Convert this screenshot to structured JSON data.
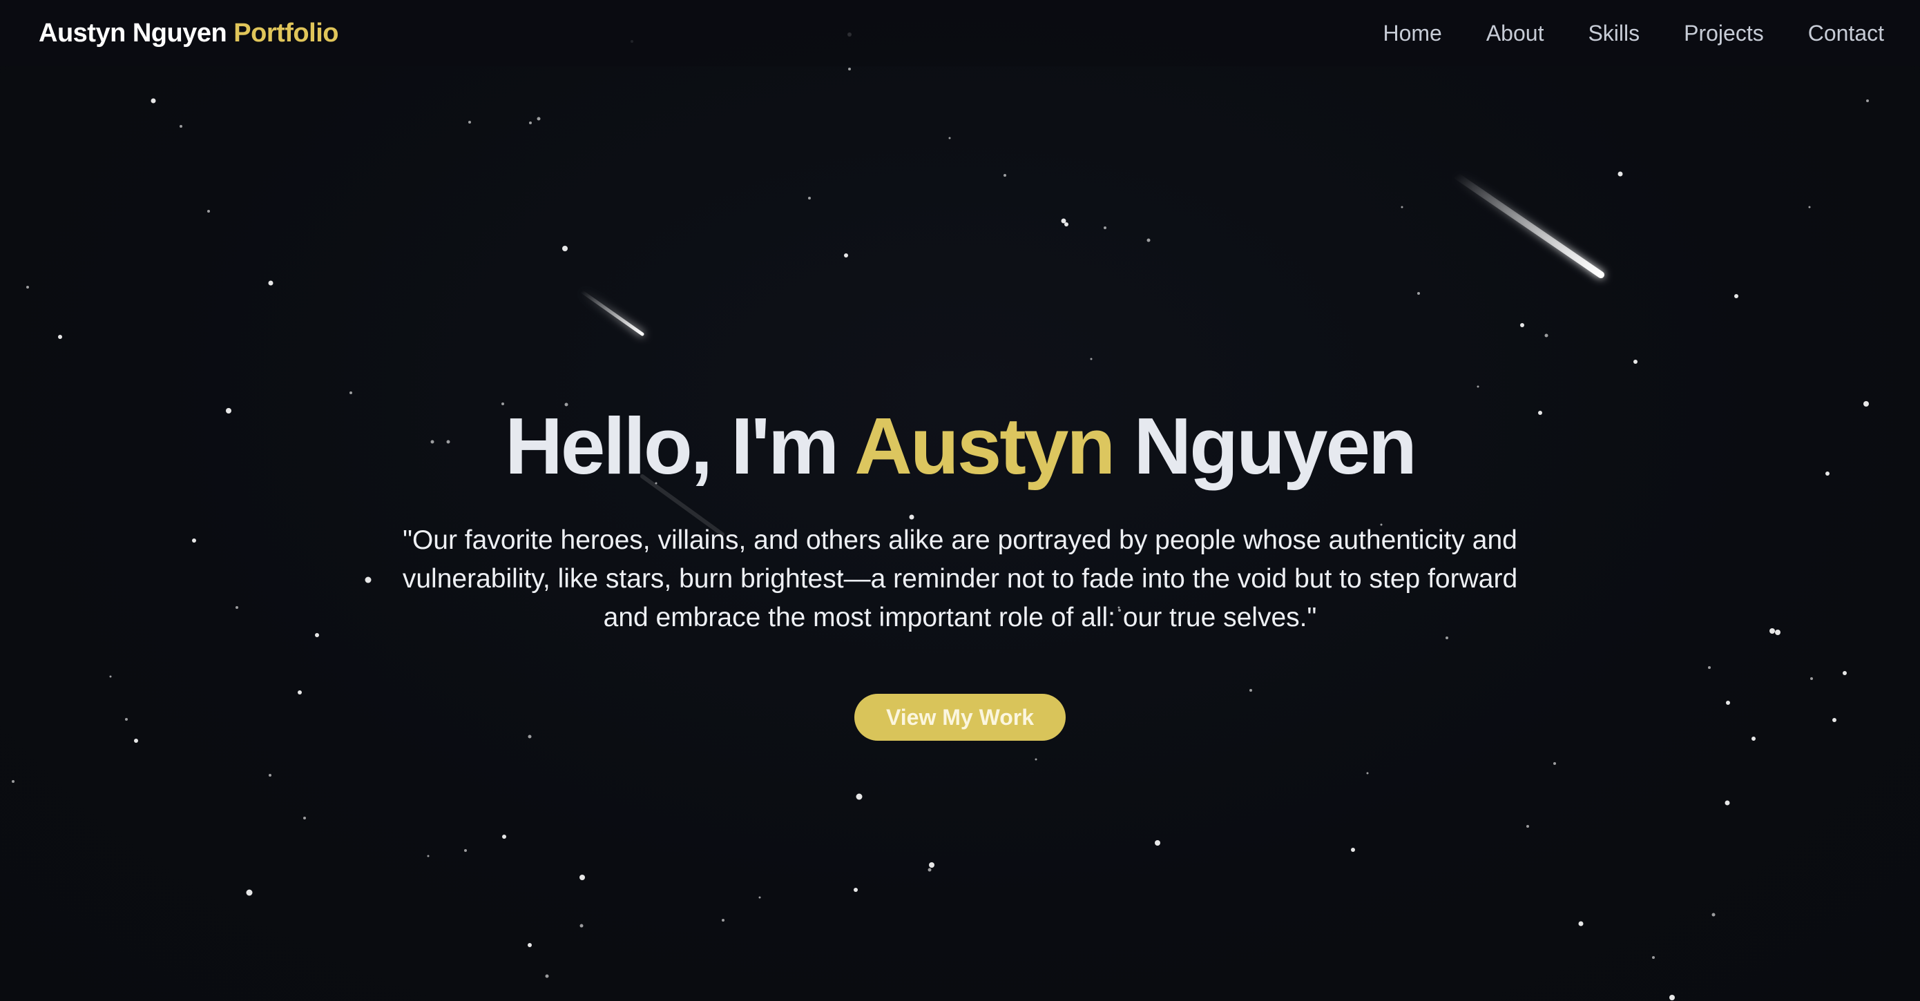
{
  "header": {
    "brand_name": "Austyn Nguyen",
    "brand_accent": "Portfolio",
    "nav": [
      {
        "label": "Home"
      },
      {
        "label": "About"
      },
      {
        "label": "Skills"
      },
      {
        "label": "Projects"
      },
      {
        "label": "Contact"
      }
    ]
  },
  "hero": {
    "greeting": "Hello, I'm",
    "first_name": "Austyn",
    "last_name": "Nguyen",
    "quote": "\"Our favorite heroes, villains, and others alike are portrayed by people whose authenticity and vulnerability, like stars, burn brightest—a reminder not to fade into the void but to step forward and embrace the most important role of all: our true selves.\"",
    "cta_label": "View My Work"
  },
  "colors": {
    "background": "#0b0d12",
    "accent": "#dcc65f",
    "text": "#e6e9ef",
    "nav_text": "#c7ccd6"
  }
}
